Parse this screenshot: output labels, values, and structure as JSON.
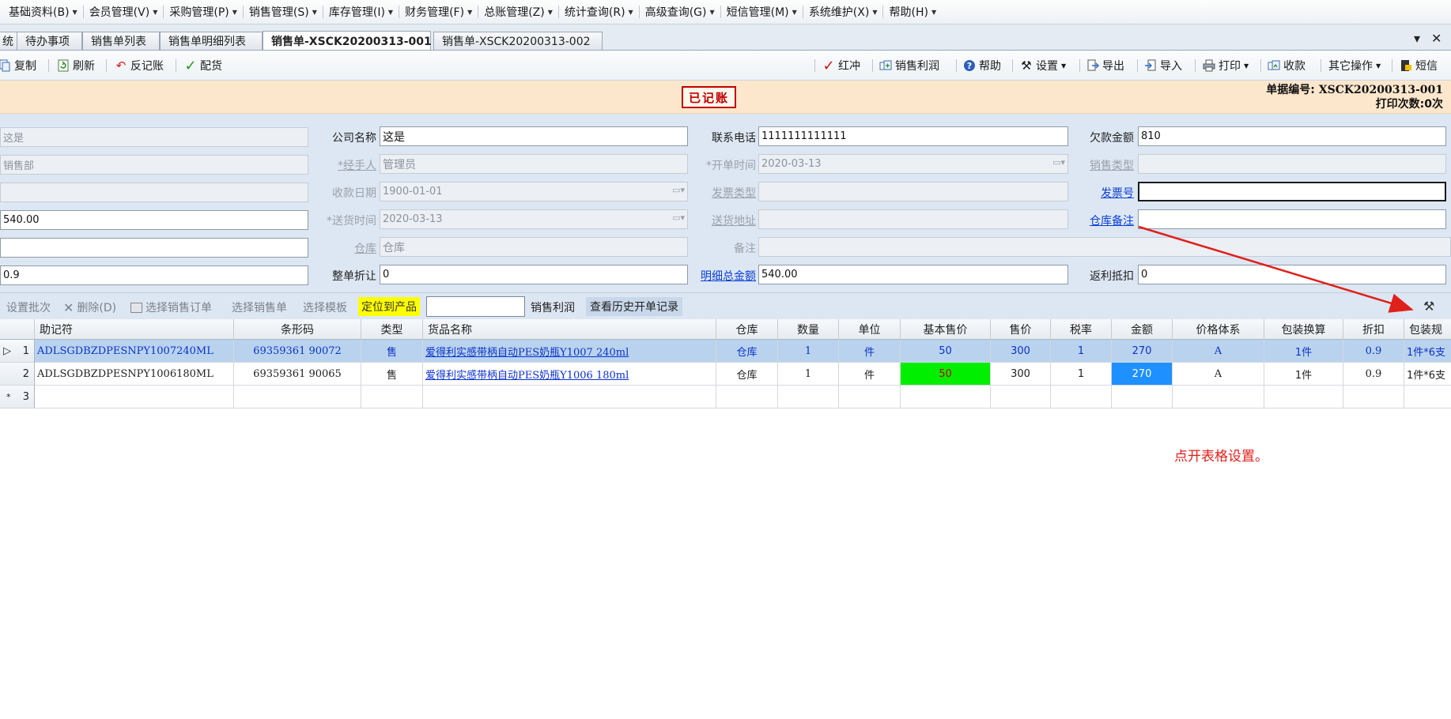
{
  "menubar": {
    "items": [
      {
        "label": "基础资料(B)"
      },
      {
        "label": "会员管理(V)"
      },
      {
        "label": "采购管理(P)"
      },
      {
        "label": "销售管理(S)"
      },
      {
        "label": "库存管理(I)"
      },
      {
        "label": "财务管理(F)"
      },
      {
        "label": "总账管理(Z)"
      },
      {
        "label": "统计查询(R)"
      },
      {
        "label": "高级查询(G)"
      },
      {
        "label": "短信管理(M)"
      },
      {
        "label": "系统维护(X)"
      },
      {
        "label": "帮助(H)"
      }
    ]
  },
  "tabs": {
    "items": [
      {
        "label": "统"
      },
      {
        "label": "待办事项"
      },
      {
        "label": "销售单列表"
      },
      {
        "label": "销售单明细列表"
      },
      {
        "label": "销售单-XSCK20200313-001"
      },
      {
        "label": "销售单-XSCK20200313-002"
      }
    ],
    "active_index": 4,
    "dropdown_glyph": "▾",
    "close_glyph": "✕"
  },
  "toolbar": {
    "left": [
      {
        "label": "复制",
        "icon": "copy-icon"
      },
      {
        "label": "刷新",
        "icon": "refresh-icon"
      },
      {
        "label": "反记账",
        "icon": "undo-icon"
      },
      {
        "label": "配货",
        "icon": "check-icon"
      }
    ],
    "right": [
      {
        "label": "红冲",
        "icon": "red-check-icon"
      },
      {
        "label": "销售利润",
        "icon": "profit-icon"
      },
      {
        "label": "帮助",
        "icon": "help-icon"
      },
      {
        "label": "设置",
        "icon": "tools-icon",
        "dropdown": true
      },
      {
        "label": "导出",
        "icon": "export-icon"
      },
      {
        "label": "导入",
        "icon": "import-icon"
      },
      {
        "label": "打印",
        "icon": "print-icon",
        "dropdown": true
      },
      {
        "label": "收款",
        "icon": "receive-icon"
      },
      {
        "label": "其它操作",
        "icon": "",
        "dropdown": true
      },
      {
        "label": "短信",
        "icon": "sms-icon"
      }
    ]
  },
  "status": {
    "stamp": "已记账",
    "doc_no_label": "单据编号:",
    "doc_no": "XSCK20200313-001",
    "print_count_label": "打印次数:",
    "print_count": "0次"
  },
  "form": {
    "col1": {
      "r1": "这是",
      "r2": "销售部",
      "r3": "",
      "r4": "540.00",
      "r5": "",
      "r6": "0.9"
    },
    "company_name": {
      "label": "公司名称",
      "value": "这是"
    },
    "handler": {
      "label": "*经手人",
      "value": "管理员"
    },
    "receive_date": {
      "label": "收款日期",
      "value": "1900-01-01"
    },
    "delivery_time": {
      "label": "*送货时间",
      "value": "2020-03-13"
    },
    "warehouse": {
      "label": "仓库",
      "value": "仓库"
    },
    "whole_discount": {
      "label": "整单折让",
      "value": "0"
    },
    "phone": {
      "label": "联系电话",
      "value": "1111111111111"
    },
    "open_time": {
      "label": "*开单时间",
      "value": "2020-03-13"
    },
    "invoice_type": {
      "label": "发票类型",
      "value": ""
    },
    "delivery_address": {
      "label": "送货地址",
      "value": ""
    },
    "remark": {
      "label": "备注",
      "value": ""
    },
    "detail_total": {
      "label": "明细总金额",
      "value": "540.00"
    },
    "owed_amount": {
      "label": "欠款金额",
      "value": "810"
    },
    "sales_type": {
      "label": "销售类型",
      "value": ""
    },
    "invoice_no": {
      "label": "发票号",
      "value": ""
    },
    "warehouse_note": {
      "label": "仓库备注",
      "value": ""
    },
    "rebate": {
      "label": "返利抵扣",
      "value": "0"
    },
    "date_button_glyph": "▭▾"
  },
  "grid_toolbar": {
    "set_batch": "设置批次",
    "delete": "删除(D)",
    "select_sales_order": "选择销售订单",
    "select_sales_doc": "选择销售单",
    "select_template": "选择模板",
    "locate_product": "定位到产品",
    "filter_value": "",
    "sales_profit": "销售利润",
    "view_history": "查看历史开单记录"
  },
  "grid": {
    "columns": [
      "助记符",
      "条形码",
      "类型",
      "货品名称",
      "仓库",
      "数量",
      "单位",
      "基本售价",
      "售价",
      "税率",
      "金额",
      "价格体系",
      "包装换算",
      "折扣",
      "包装规"
    ],
    "rows": [
      {
        "marker": "▷",
        "no": "1",
        "cells": [
          "ADLSGDBZDPESNPY1007240ML",
          "69359361 90072",
          "售",
          "爱得利实感带柄自动PES奶瓶Y1007 240ml",
          "仓库",
          "1",
          "件",
          "50",
          "300",
          "1",
          "270",
          "A",
          "1件",
          "0.9",
          "1件*6支"
        ]
      },
      {
        "marker": "",
        "no": "2",
        "cells": [
          "ADLSGDBZDPESNPY1006180ML",
          "69359361 90065",
          "售",
          "爱得利实感带柄自动PES奶瓶Y1006 180ml",
          "仓库",
          "1",
          "件",
          "50",
          "300",
          "1",
          "270",
          "A",
          "1件",
          "0.9",
          "1件*6支"
        ]
      },
      {
        "marker": "*",
        "no": "3",
        "cells": [
          "",
          "",
          "",
          "",
          "",
          "",
          "",
          "",
          "",
          "",
          "",
          "",
          "",
          "",
          ""
        ]
      }
    ],
    "highlight_colors": {
      "basic_price": "#00ee00",
      "amount": "#1e90ff",
      "selected_row": "#b9d3ee"
    }
  },
  "annotation": {
    "text": "点开表格设置。",
    "color": "#e0201b"
  }
}
